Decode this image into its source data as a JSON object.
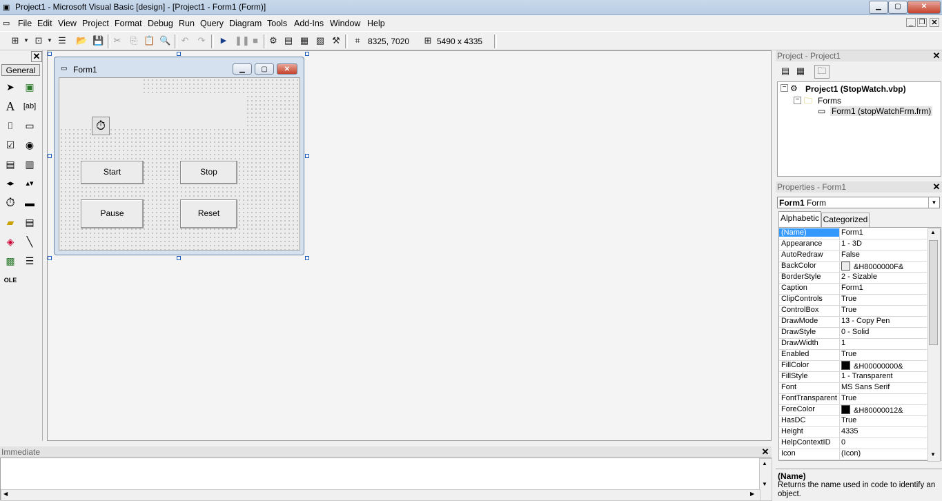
{
  "window": {
    "title": "Project1 - Microsoft Visual Basic [design] - [Project1 - Form1 (Form)]",
    "minimize": "▁",
    "maximize": "▢",
    "close": "✕"
  },
  "menu": {
    "items": [
      "File",
      "Edit",
      "View",
      "Project",
      "Format",
      "Debug",
      "Run",
      "Query",
      "Diagram",
      "Tools",
      "Add-Ins",
      "Window",
      "Help"
    ]
  },
  "toolbar": {
    "position": "8325, 7020",
    "size": "5490 x 4335"
  },
  "toolbox": {
    "tab": "General",
    "close": "✕"
  },
  "form": {
    "caption": "Form1",
    "buttons": {
      "start": "Start",
      "stop": "Stop",
      "pause": "Pause",
      "reset": "Reset"
    },
    "timer_icon": "stopwatch-icon"
  },
  "project_panel": {
    "title": "Project - Project1",
    "close": "✕",
    "tree": {
      "project": "Project1 (StopWatch.vbp)",
      "folder": "Forms",
      "form": "Form1 (stopWatchFrm.frm)"
    }
  },
  "properties_panel": {
    "title": "Properties - Form1",
    "close": "✕",
    "object_name": "Form1",
    "object_type": "Form",
    "tabs": [
      "Alphabetic",
      "Categorized"
    ],
    "rows": [
      {
        "name": "(Name)",
        "value": "Form1"
      },
      {
        "name": "Appearance",
        "value": "1 - 3D"
      },
      {
        "name": "AutoRedraw",
        "value": "False"
      },
      {
        "name": "BackColor",
        "value": "&H8000000F&",
        "swatch": "#ececec"
      },
      {
        "name": "BorderStyle",
        "value": "2 - Sizable"
      },
      {
        "name": "Caption",
        "value": "Form1"
      },
      {
        "name": "ClipControls",
        "value": "True"
      },
      {
        "name": "ControlBox",
        "value": "True"
      },
      {
        "name": "DrawMode",
        "value": "13 - Copy Pen"
      },
      {
        "name": "DrawStyle",
        "value": "0 - Solid"
      },
      {
        "name": "DrawWidth",
        "value": "1"
      },
      {
        "name": "Enabled",
        "value": "True"
      },
      {
        "name": "FillColor",
        "value": "&H00000000&",
        "swatch": "#000000"
      },
      {
        "name": "FillStyle",
        "value": "1 - Transparent"
      },
      {
        "name": "Font",
        "value": "MS Sans Serif"
      },
      {
        "name": "FontTransparent",
        "value": "True"
      },
      {
        "name": "ForeColor",
        "value": "&H80000012&",
        "swatch": "#000000"
      },
      {
        "name": "HasDC",
        "value": "True"
      },
      {
        "name": "Height",
        "value": "4335"
      },
      {
        "name": "HelpContextID",
        "value": "0"
      },
      {
        "name": "Icon",
        "value": "(Icon)"
      }
    ],
    "description_title": "(Name)",
    "description_text": "Returns the name used in code to identify an object."
  },
  "immediate": {
    "title": "Immediate",
    "close": "✕"
  },
  "colors": {
    "selection": "#3399ff",
    "title_gradient": "#c9d9ec"
  }
}
